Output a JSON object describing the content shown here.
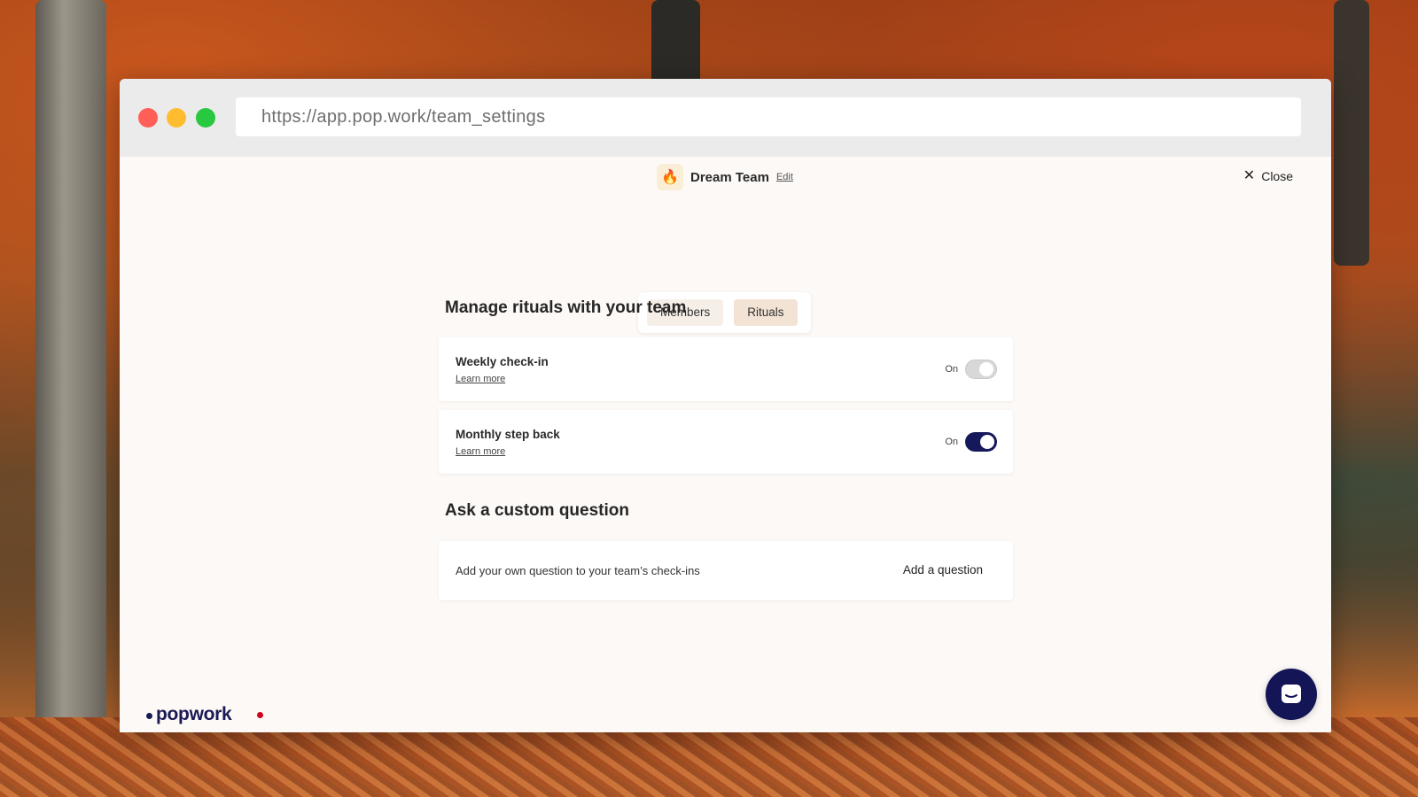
{
  "browser": {
    "url": "https://app.pop.work/team_settings"
  },
  "header": {
    "team_emoji": "🔥",
    "team_name": "Dream Team",
    "edit_label": "Edit",
    "close_label": "Close"
  },
  "tabs": [
    {
      "label": "Members",
      "active": false
    },
    {
      "label": "Rituals",
      "active": true
    }
  ],
  "rituals": {
    "title": "Manage rituals with your team",
    "items": [
      {
        "name": "Weekly check-in",
        "link": "Learn more",
        "status": "On",
        "toggle_color": "#d8d8d8"
      },
      {
        "name": "Monthly step back",
        "link": "Learn more",
        "status": "On",
        "toggle_color": "#16185c"
      }
    ]
  },
  "custom_question": {
    "title": "Ask a custom question",
    "description": "Add your own question to your team’s check-ins",
    "button_label": "Add a question"
  },
  "footer": {
    "logo_text": "popwork",
    "brand_color": "#141556"
  }
}
